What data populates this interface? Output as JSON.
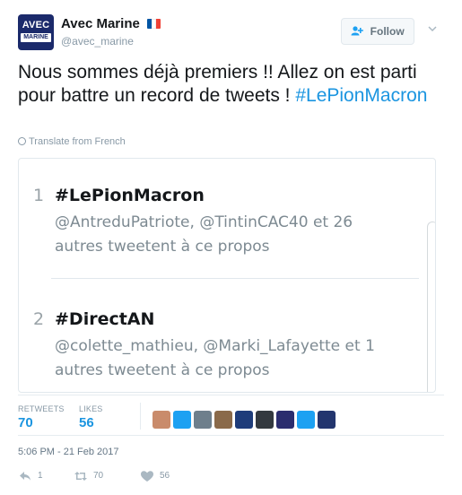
{
  "author": {
    "avatar_line1": "AVEC",
    "avatar_line2": "MARINE",
    "display_name": "Avec Marine",
    "handle": "@avec_marine",
    "flag_colors": [
      "#0055a4",
      "#ffffff",
      "#ef4135"
    ]
  },
  "follow_button": {
    "label": "Follow",
    "icon": "add-user-icon"
  },
  "menu_icon": "chevron-down-icon",
  "tweet": {
    "text": "Nous sommes déjà premiers !! Allez on est parti pour battre un record de tweets ! ",
    "hashtag": "#LePionMacron",
    "translate_label": "Translate from French",
    "translate_icon": "globe-icon"
  },
  "media": {
    "trends": [
      {
        "rank": "1",
        "tag": "#LePionMacron",
        "description": "@AntreduPatriote, @TintinCAC40 et 26 autres tweetent à ce propos"
      },
      {
        "rank": "2",
        "tag": "#DirectAN",
        "description": "@colette_mathieu, @Marki_Lafayette et 1 autres tweetent à ce propos"
      }
    ]
  },
  "stats": {
    "retweets_label": "RETWEETS",
    "retweets_count": "70",
    "likes_label": "LIKES",
    "likes_count": "56",
    "likers": [
      {
        "name": "liker-avatar-1",
        "color": "#c98b6b"
      },
      {
        "name": "liker-avatar-2",
        "color": "#1da1f2"
      },
      {
        "name": "liker-avatar-3",
        "color": "#6e7f8c"
      },
      {
        "name": "liker-avatar-4",
        "color": "#8a6a4a"
      },
      {
        "name": "liker-avatar-5",
        "color": "#1e3c7a"
      },
      {
        "name": "liker-avatar-6",
        "color": "#33393f"
      },
      {
        "name": "liker-avatar-7",
        "color": "#2b2d6e"
      },
      {
        "name": "liker-avatar-8",
        "color": "#1da1f2"
      },
      {
        "name": "liker-avatar-9",
        "color": "#23356e"
      }
    ]
  },
  "timestamp": "5:06 PM - 21 Feb 2017",
  "actions": {
    "reply_count": "1",
    "retweet_count": "70",
    "like_count": "56",
    "reply_icon": "reply-icon",
    "retweet_icon": "retweet-icon",
    "like_icon": "heart-icon"
  },
  "colors": {
    "link_blue": "#1b95e0",
    "muted_gray": "#8899a6",
    "avatar_navy": "#1b2a6b"
  }
}
